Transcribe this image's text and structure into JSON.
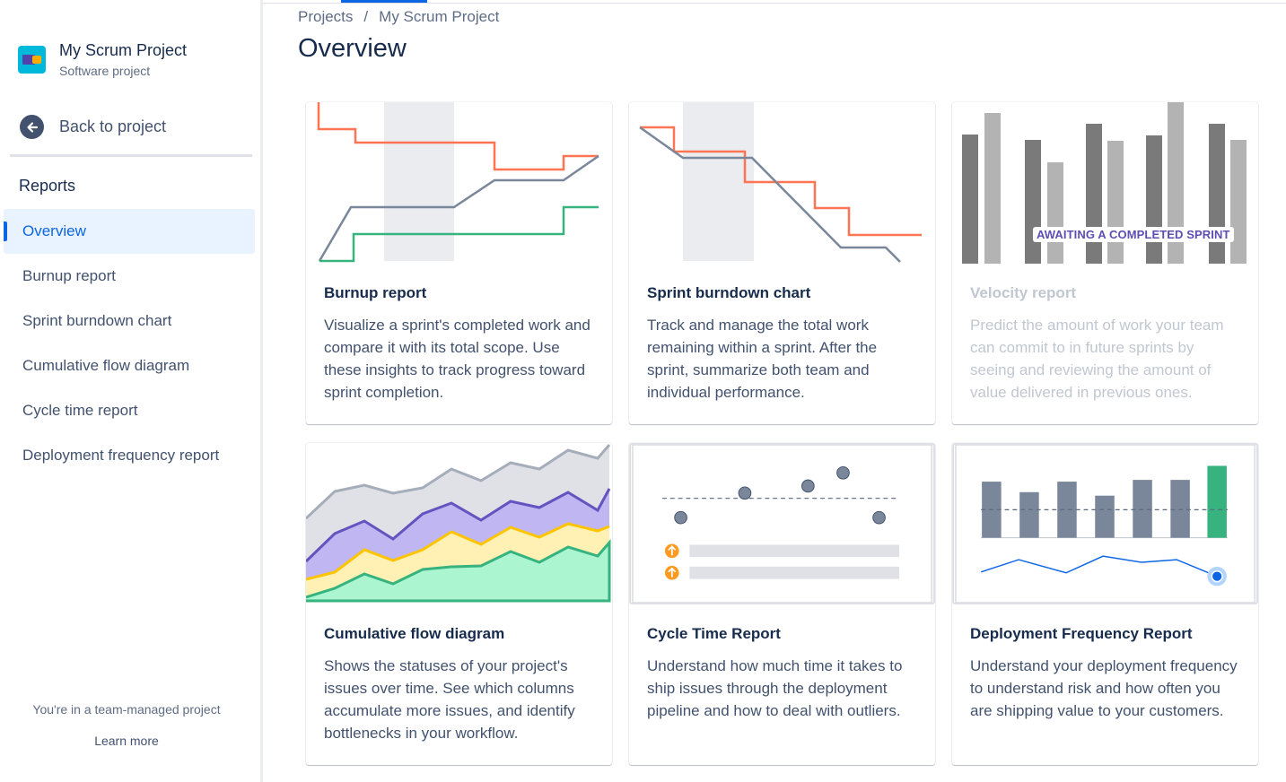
{
  "sidebar": {
    "project_name": "My Scrum Project",
    "project_type": "Software project",
    "back_label": "Back to project",
    "section_heading": "Reports",
    "items": [
      {
        "label": "Overview",
        "active": true
      },
      {
        "label": "Burnup report"
      },
      {
        "label": "Sprint burndown chart"
      },
      {
        "label": "Cumulative flow diagram"
      },
      {
        "label": "Cycle time report"
      },
      {
        "label": "Deployment frequency report"
      }
    ],
    "team_note": "You're in a team-managed project",
    "learn_more": "Learn more"
  },
  "breadcrumb": [
    "Projects",
    "My Scrum Project"
  ],
  "breadcrumb_separator": "/",
  "page_title": "Overview",
  "cards": [
    {
      "title": "Burnup report",
      "description": "Visualize a sprint's completed work and compare it with its total scope. Use these insights to track progress toward sprint completion."
    },
    {
      "title": "Sprint burndown chart",
      "description": "Track and manage the total work remaining within a sprint. After the sprint, summarize both team and individual performance."
    },
    {
      "title": "Velocity report",
      "description": "Predict the amount of work your team can commit to in future sprints by seeing and reviewing the amount of value delivered in previous ones.",
      "disabled": true,
      "badge": "AWAITING A COMPLETED SPRINT"
    },
    {
      "title": "Cumulative flow diagram",
      "description": "Shows the statuses of your project's issues over time. See which columns accumulate more issues, and identify bottlenecks in your workflow."
    },
    {
      "title": "Cycle Time Report",
      "description": "Understand how much time it takes to ship issues through the deployment pipeline and how to deal with outliers."
    },
    {
      "title": "Deployment Frequency Report",
      "description": "Understand your deployment frequency to understand risk and how often you are shipping value to your customers."
    }
  ],
  "colors": {
    "accent": "#0c66e4",
    "burnup_scope": "#ff7452",
    "burnup_completed": "#36b37e",
    "line_gray": "#7a869a",
    "cfd_purple": "#6554c0",
    "cfd_yellow": "#ffc400",
    "cfd_green": "#36b37e",
    "deploy_highlight": "#36b37e",
    "outlier_orange": "#ff991f"
  }
}
